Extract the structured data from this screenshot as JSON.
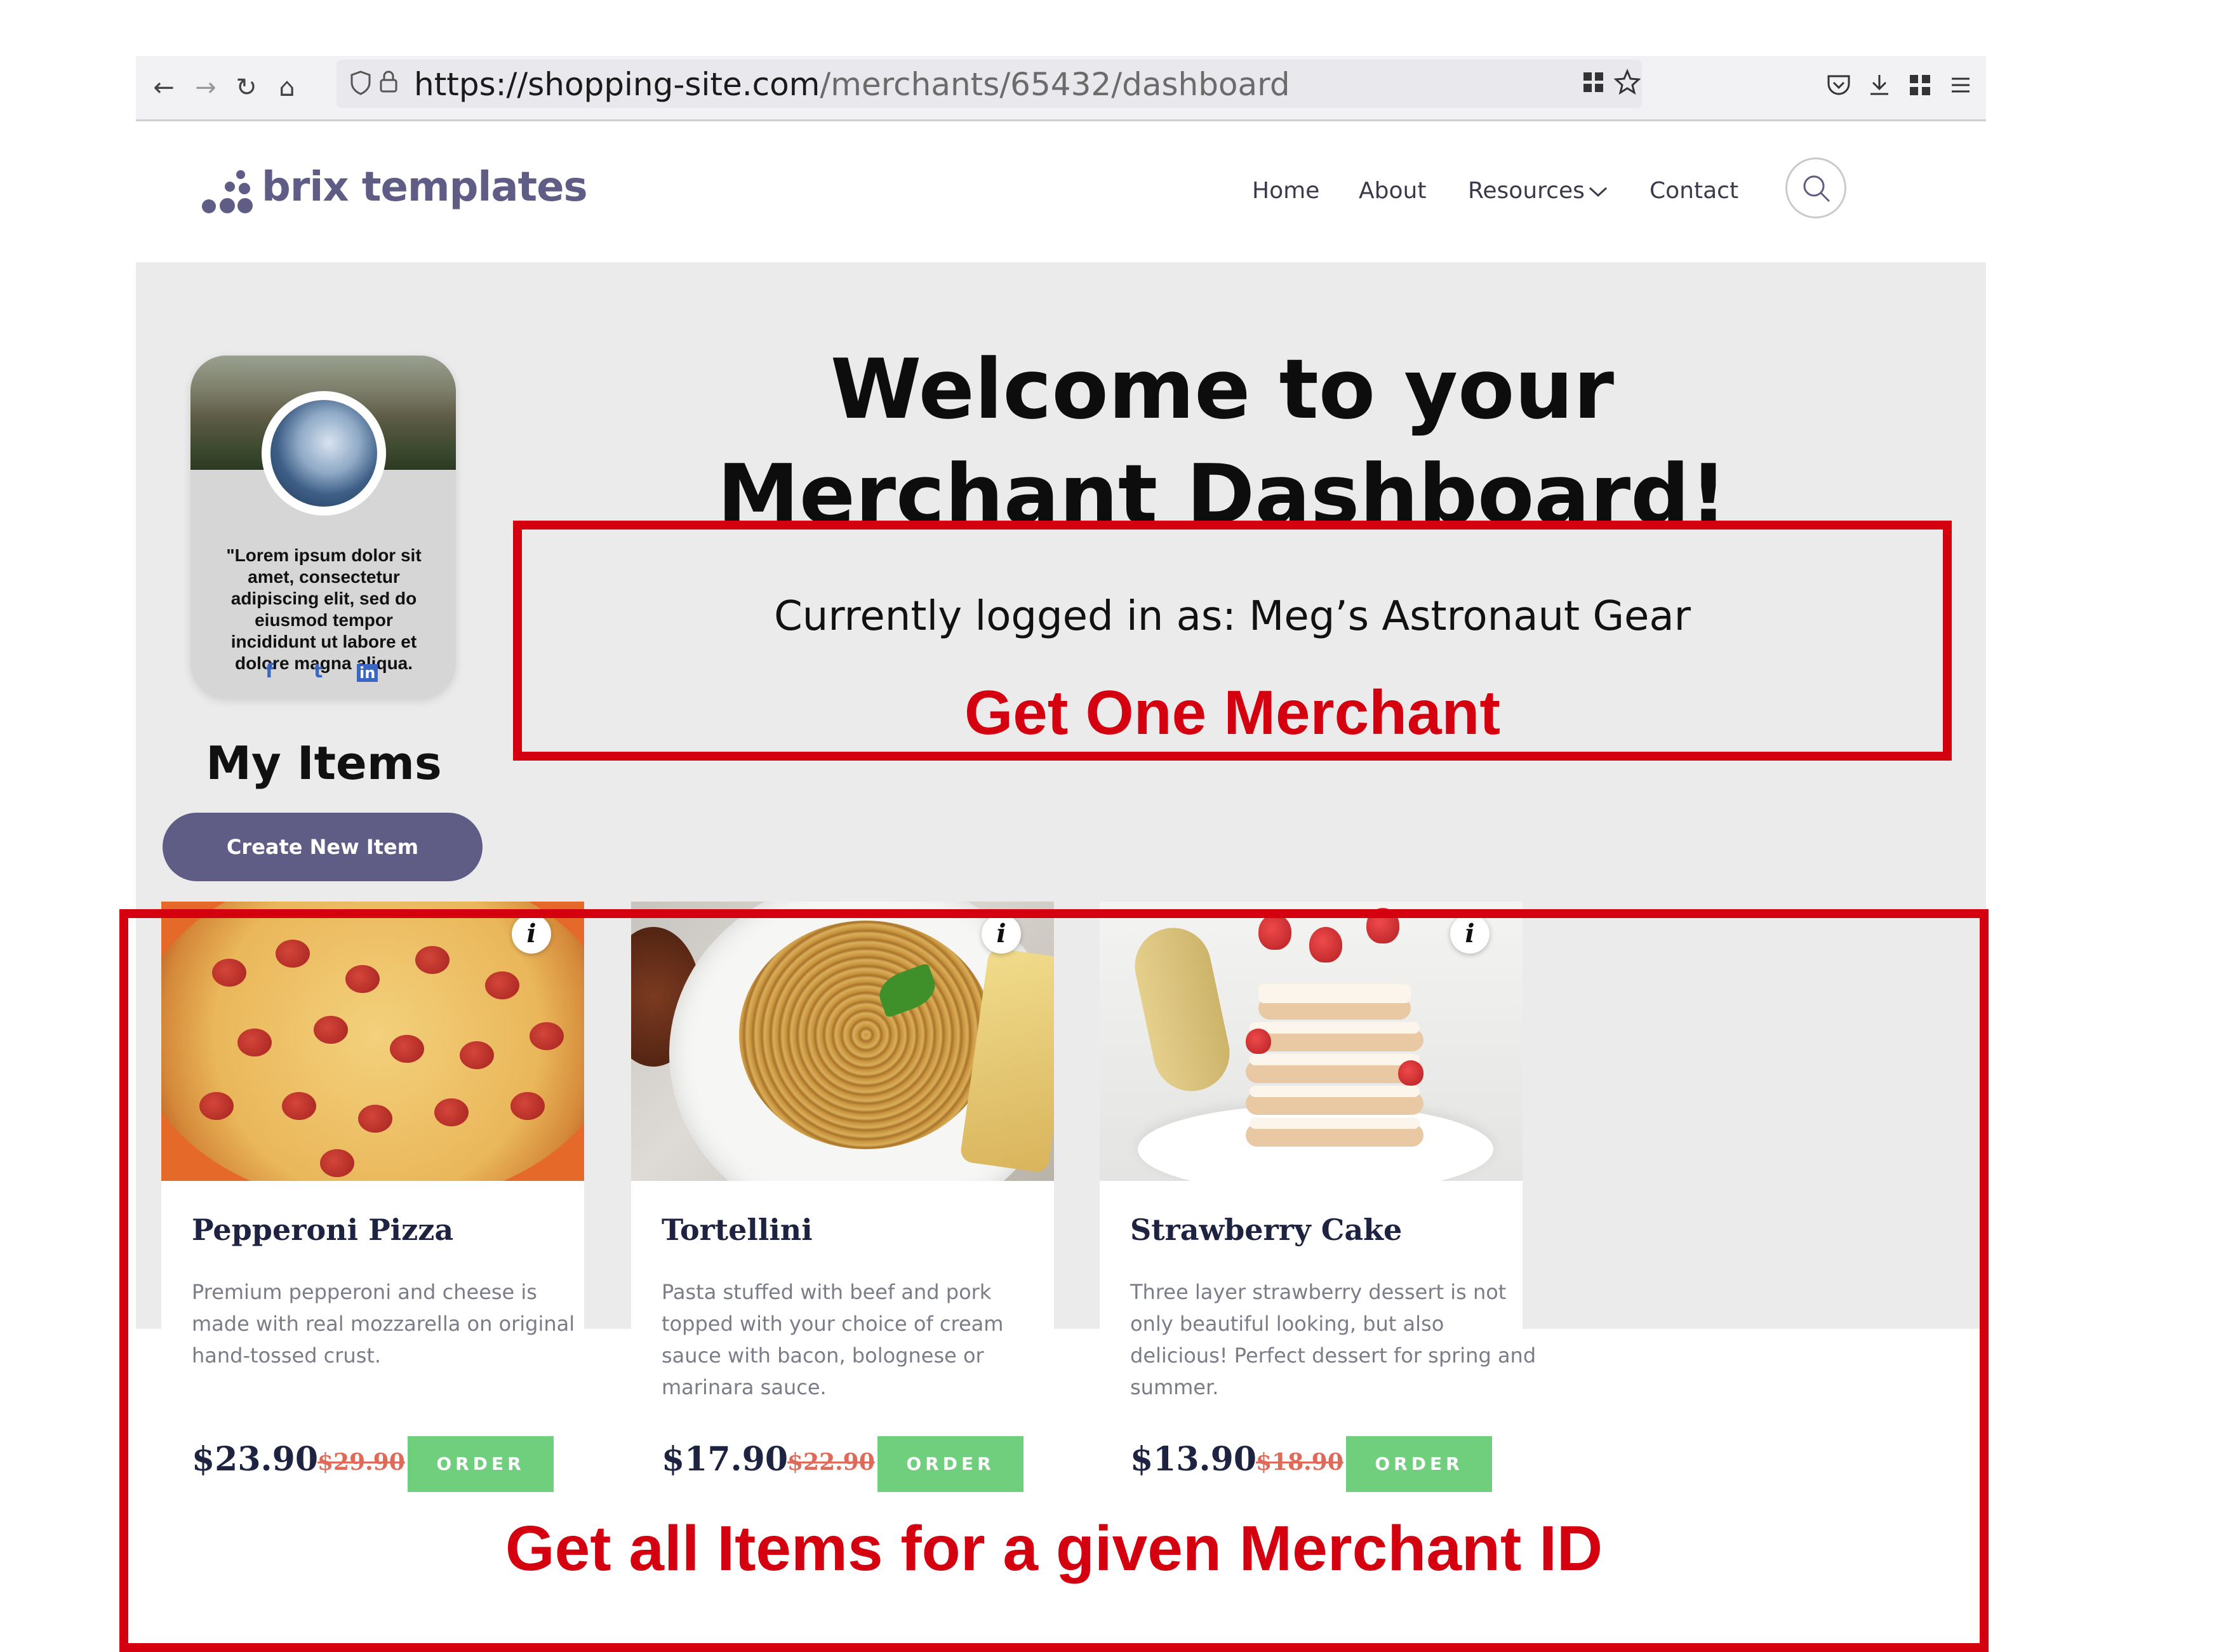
{
  "browser": {
    "url_host": "https://shopping-site.com",
    "url_path": "/merchants/65432/dashboard",
    "back": "←",
    "forward": "→",
    "reload": "↻",
    "home": "⌂"
  },
  "header": {
    "logo": "brix templates",
    "nav": [
      "Home",
      "About",
      "Resources",
      "Contact"
    ],
    "resources_chevron": "⌄"
  },
  "profile": {
    "quote": "\"Lorem ipsum dolor sit amet, consectetur adipiscing elit, sed do eiusmod tempor incididunt ut labore et dolore magna aliqua.",
    "social": [
      "f",
      "t",
      "in"
    ]
  },
  "dashboard": {
    "welcome": "Welcome to your Merchant Dashboard!",
    "logged_in": "Currently logged in as: Meg’s Astronaut Gear",
    "my_items": "My Items",
    "create_button": "Create New Item"
  },
  "annotations": {
    "get_one": "Get One Merchant",
    "get_all": "Get all Items for a given Merchant ID",
    "color": "#d4000f"
  },
  "items": [
    {
      "title": "Pepperoni Pizza",
      "description": "Premium pepperoni and cheese is made with real mozzarella on original hand-tossed crust.",
      "price": "$23.90",
      "old_price": "$29.90",
      "order": "ORDER"
    },
    {
      "title": "Tortellini",
      "description": "Pasta stuffed with beef and pork topped with your choice of cream sauce with bacon, bolognese or marinara sauce.",
      "price": "$17.90",
      "old_price": "$22.90",
      "order": "ORDER"
    },
    {
      "title": "Strawberry Cake",
      "description": "Three layer strawberry dessert is not only beautiful looking, but also delicious! Perfect dessert for spring and summer.",
      "price": "$13.90",
      "old_price": "$18.90",
      "order": "ORDER"
    }
  ],
  "info_glyph": "i",
  "colors": {
    "brand": "#5f5c86",
    "order_button": "#6fcf7c",
    "old_price": "#e06a5a"
  }
}
